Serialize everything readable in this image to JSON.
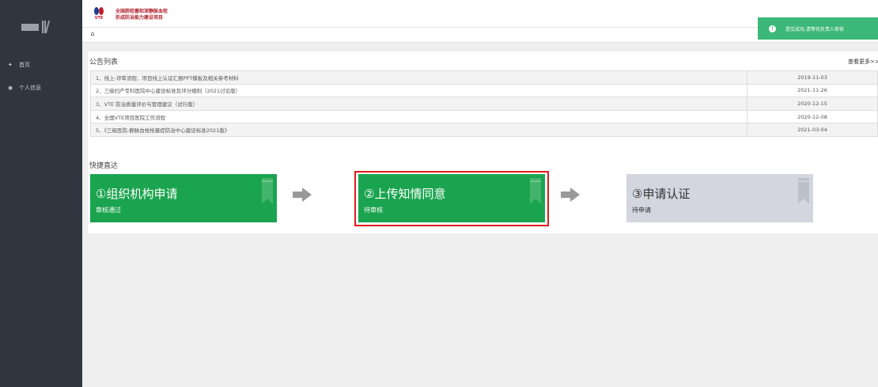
{
  "header": {
    "title_line1": "全国肺栓塞和深静脉血栓",
    "title_line2": "形成防治能力建设项目",
    "logo_text": "VTE"
  },
  "sidebar": {
    "items": [
      {
        "label": "首页",
        "icon": "home-icon"
      },
      {
        "label": "个人信息",
        "icon": "user-info-icon"
      }
    ]
  },
  "toast": {
    "message": "提交成功,请等待负责人审核",
    "icon": "info-icon",
    "color": "#3cb878"
  },
  "notices": {
    "title": "公告列表",
    "more_label": "查看更多>>",
    "rows": [
      {
        "text": "1、线上-评审流程、项目线上认证汇报PPT模板及相关参考材料",
        "date": "2019-11-03"
      },
      {
        "text": "2、三级妇产专科医院中心建设标准及评分细则（2021讨论版）",
        "date": "2021-11-26"
      },
      {
        "text": "3、VTE 防治质量评价与管理建议（试行版）",
        "date": "2020-12-15"
      },
      {
        "text": "4、全国VTE项目医院工作流程",
        "date": "2020-12-08"
      },
      {
        "text": "5、《三级医院-静脉血栓栓塞症防治中心建设标准2021版》",
        "date": "2021-03-04"
      }
    ]
  },
  "quick": {
    "title": "快捷直达",
    "cards": [
      {
        "title": "①组织机构申请",
        "status": "审核通过",
        "color": "#1ba44f"
      },
      {
        "title": "②上传知情同意",
        "status": "待审核",
        "color": "#1ba44f"
      },
      {
        "title": "③申请认证",
        "status": "待申请",
        "color": "#d3d6de"
      }
    ]
  }
}
